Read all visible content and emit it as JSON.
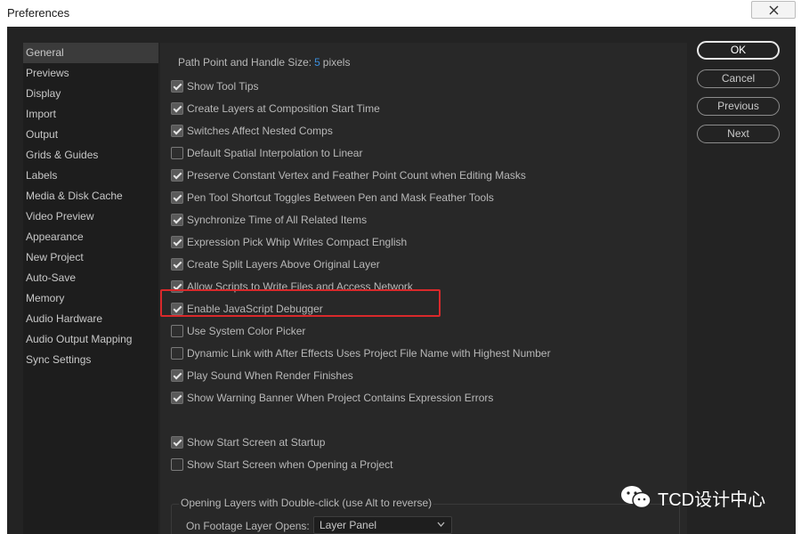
{
  "window": {
    "title": "Preferences"
  },
  "sidebar": {
    "items": [
      {
        "label": "General",
        "active": true
      },
      {
        "label": "Previews"
      },
      {
        "label": "Display"
      },
      {
        "label": "Import"
      },
      {
        "label": "Output"
      },
      {
        "label": "Grids & Guides"
      },
      {
        "label": "Labels"
      },
      {
        "label": "Media & Disk Cache"
      },
      {
        "label": "Video Preview"
      },
      {
        "label": "Appearance"
      },
      {
        "label": "New Project"
      },
      {
        "label": "Auto-Save"
      },
      {
        "label": "Memory"
      },
      {
        "label": "Audio Hardware"
      },
      {
        "label": "Audio Output Mapping"
      },
      {
        "label": "Sync Settings"
      }
    ]
  },
  "general": {
    "path_label": "Path Point and Handle Size:",
    "path_value": "5",
    "path_unit": "pixels",
    "options": [
      {
        "label": "Show Tool Tips",
        "checked": true
      },
      {
        "label": "Create Layers at Composition Start Time",
        "checked": true
      },
      {
        "label": "Switches Affect Nested Comps",
        "checked": true
      },
      {
        "label": "Default Spatial Interpolation to Linear",
        "checked": false
      },
      {
        "label": "Preserve Constant Vertex and Feather Point Count when Editing Masks",
        "checked": true
      },
      {
        "label": "Pen Tool Shortcut Toggles Between Pen and Mask Feather Tools",
        "checked": true
      },
      {
        "label": "Synchronize Time of All Related Items",
        "checked": true
      },
      {
        "label": "Expression Pick Whip Writes Compact English",
        "checked": true
      },
      {
        "label": "Create Split Layers Above Original Layer",
        "checked": true
      },
      {
        "label": "Allow Scripts to Write Files and Access Network",
        "checked": true
      },
      {
        "label": "Enable JavaScript Debugger",
        "checked": true
      },
      {
        "label": "Use System Color Picker",
        "checked": false
      },
      {
        "label": "Dynamic Link with After Effects Uses Project File Name with Highest Number",
        "checked": false
      },
      {
        "label": "Play Sound When Render Finishes",
        "checked": true
      },
      {
        "label": "Show Warning Banner When Project Contains Expression Errors",
        "checked": true
      }
    ],
    "startup_options": [
      {
        "label": "Show Start Screen at Startup",
        "checked": true
      },
      {
        "label": "Show Start Screen when Opening a Project",
        "checked": false
      }
    ],
    "double_click_group": {
      "legend": "Opening Layers with Double-click (use Alt to reverse)",
      "footage_label": "On Footage Layer Opens:",
      "footage_value": "Layer Panel"
    }
  },
  "buttons": {
    "ok": "OK",
    "cancel": "Cancel",
    "previous": "Previous",
    "next": "Next"
  },
  "watermark": {
    "text": "TCD设计中心",
    "icon": "wechat-icon"
  },
  "colors": {
    "highlight": "#d9292b",
    "value_accent": "#3b8fde",
    "dialog_bg": "#232323"
  }
}
